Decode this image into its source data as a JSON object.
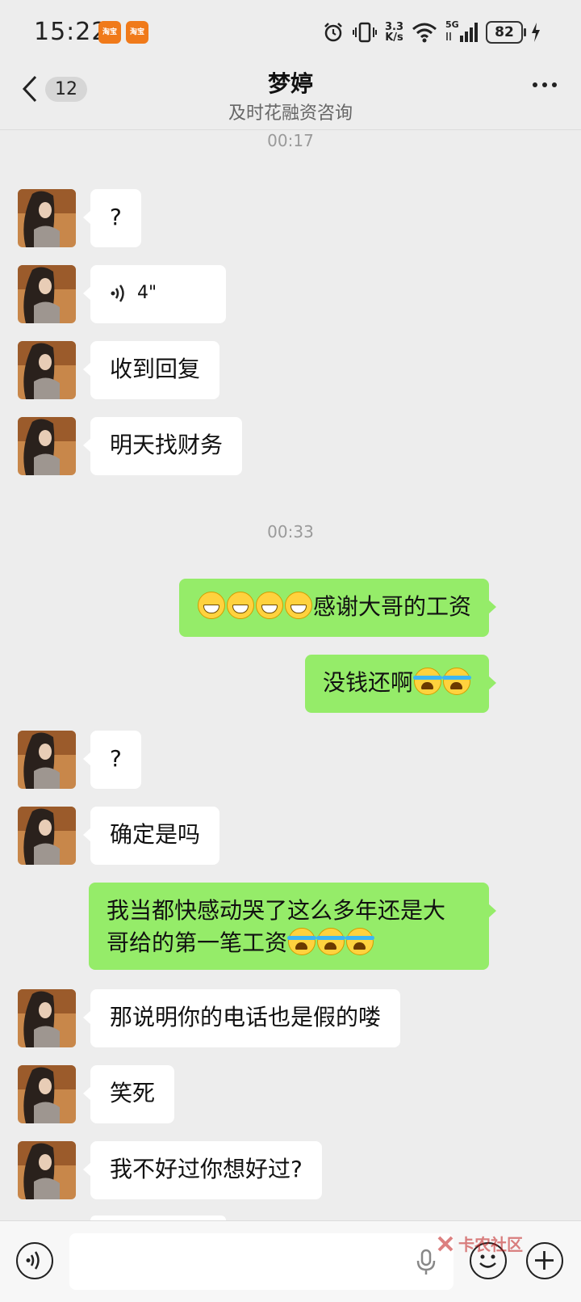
{
  "status_bar": {
    "time": "15:22",
    "app_badges": [
      "淘宝",
      "淘宝"
    ],
    "net_speed_value": "3.3",
    "net_speed_unit": "K/s",
    "network": "5G",
    "battery": "82"
  },
  "header": {
    "back_count": "12",
    "title": "梦婷",
    "subtitle": "及时花融资咨询"
  },
  "timestamps": [
    "00:17",
    "00:33"
  ],
  "messages": [
    {
      "side": "left",
      "text": "?"
    },
    {
      "side": "left",
      "type": "voice",
      "text": "4\""
    },
    {
      "side": "left",
      "text": "收到回复"
    },
    {
      "side": "left",
      "text": "明天找财务"
    },
    {
      "side": "right",
      "emoji_prefix": [
        "grin",
        "grin",
        "grin",
        "grin"
      ],
      "text": "感谢大哥的工资"
    },
    {
      "side": "right",
      "text": "没钱还啊",
      "emoji_suffix": [
        "cry",
        "cry"
      ]
    },
    {
      "side": "left",
      "text": "?"
    },
    {
      "side": "left",
      "text": "确定是吗"
    },
    {
      "side": "right",
      "text_line1": "我当都快感动哭了这么多年还是大",
      "text_line2": "哥给的第一笔工资",
      "emoji_suffix": [
        "cry",
        "cry",
        "cry"
      ]
    },
    {
      "side": "left",
      "text": "那说明你的电话也是假的喽"
    },
    {
      "side": "left",
      "text": "笑死"
    },
    {
      "side": "left",
      "text": "我不好过你想好过?"
    }
  ],
  "input_bar": {
    "placeholder": "",
    "watermark": "卡农社区"
  },
  "colors": {
    "background": "#ededed",
    "bubble_incoming": "#ffffff",
    "bubble_outgoing": "#95ec69"
  }
}
